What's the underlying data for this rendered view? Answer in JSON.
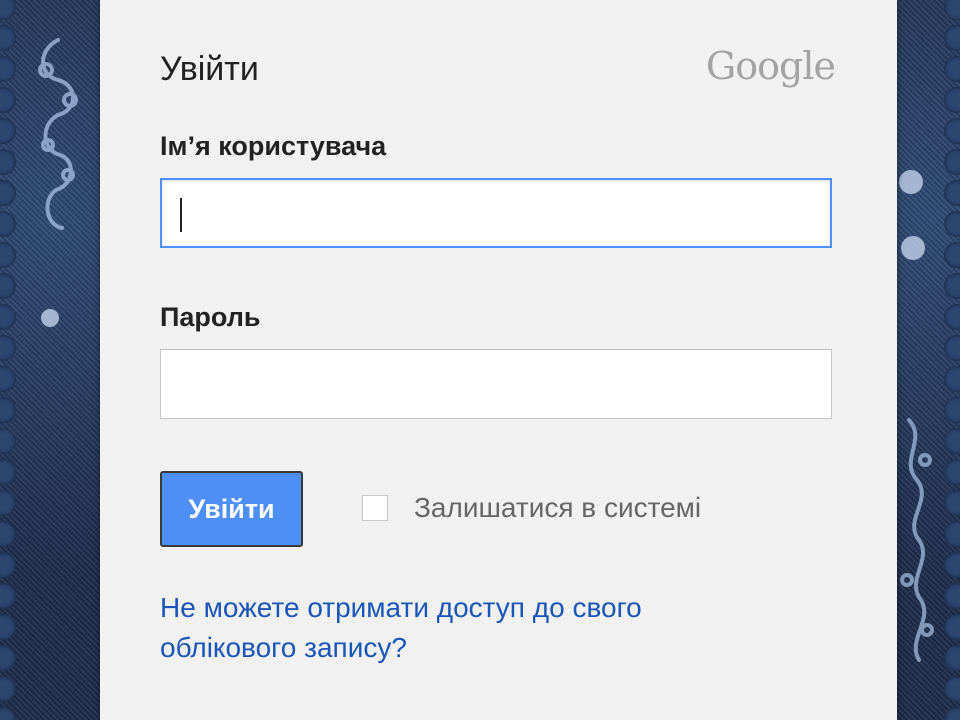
{
  "header": {
    "title": "Увійти",
    "logo_text": "Google"
  },
  "form": {
    "username_label": "Ім’я користувача",
    "username_value": "",
    "password_label": "Пароль",
    "password_value": "",
    "signin_button": "Увійти",
    "remember_label": "Залишатися в системі",
    "remember_checked": false,
    "help_link": "Не можете отримати доступ до свого облікового запису?"
  },
  "colors": {
    "accent": "#4d8ff5",
    "focus_border": "#4d90fe",
    "link": "#1a55b8",
    "background_denim": "#24385e"
  }
}
